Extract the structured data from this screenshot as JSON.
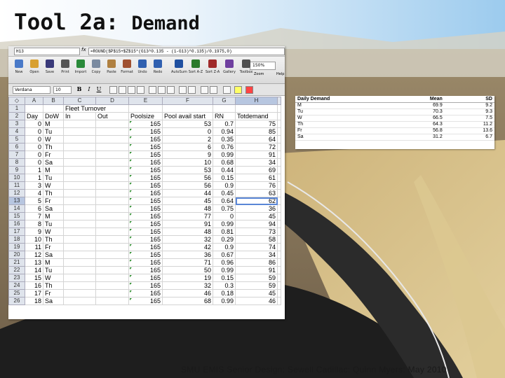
{
  "slide": {
    "title_main": "Tool 2a:",
    "title_sub": "Demand",
    "footer": "SMU EMIS Senior Design:  Sewell Cadillac:  Quinn Myers:  May 2010"
  },
  "spreadsheet": {
    "name_box": "H13",
    "fx_label": "fx",
    "formula": "=ROUND($P$15+$Z$15*(G13^0.135 - (1-G13)^0.135)/0.1975,0)",
    "toolbar": [
      {
        "label": "New",
        "icon": "new-icon",
        "color": "#4a7ac8"
      },
      {
        "label": "Open",
        "icon": "open-icon",
        "color": "#d8a030"
      },
      {
        "label": "Save",
        "icon": "save-icon",
        "color": "#3a3a7a"
      },
      {
        "label": "Print",
        "icon": "print-icon",
        "color": "#555555"
      },
      {
        "label": "Import",
        "icon": "import-icon",
        "color": "#2a8a3a"
      },
      {
        "label": "Copy",
        "icon": "copy-icon",
        "color": "#7a8aa0"
      },
      {
        "label": "Paste",
        "icon": "paste-icon",
        "color": "#b08040"
      },
      {
        "label": "Format",
        "icon": "format-icon",
        "color": "#a05030"
      },
      {
        "label": "Undo",
        "icon": "undo-icon",
        "color": "#3060b0"
      },
      {
        "label": "Redo",
        "icon": "redo-icon",
        "color": "#3060b0"
      },
      {
        "label": "AutoSum",
        "icon": "autosum-icon",
        "color": "#2050a0"
      },
      {
        "label": "Sort A-Z",
        "icon": "sort-az-icon",
        "color": "#2a7a2a"
      },
      {
        "label": "Sort Z-A",
        "icon": "sort-za-icon",
        "color": "#a02a2a"
      },
      {
        "label": "Gallery",
        "icon": "gallery-icon",
        "color": "#7040a0"
      },
      {
        "label": "Toolbox",
        "icon": "toolbox-icon",
        "color": "#505050"
      }
    ],
    "zoom": "150%",
    "zoom_label": "Zoom",
    "help_label": "Help",
    "font_name": "Verdana",
    "font_size": "10",
    "bold_glyph": "B",
    "italic_glyph": "I",
    "underline_glyph": "U",
    "columns": [
      "A",
      "B",
      "C",
      "D",
      "E",
      "F",
      "G",
      "H"
    ],
    "selected_row": "13",
    "header_row": [
      "Day",
      "DoW",
      "In",
      "Out",
      "Poolsize",
      "Pool avail start",
      "RN",
      "Totdemand"
    ],
    "group_label": "Fleet Turnover",
    "rows": [
      [
        "0",
        "M",
        "",
        "",
        "165",
        "53",
        "0.7",
        "75"
      ],
      [
        "0",
        "Tu",
        "",
        "",
        "165",
        "0",
        "0.94",
        "85"
      ],
      [
        "0",
        "W",
        "",
        "",
        "165",
        "2",
        "0.35",
        "64"
      ],
      [
        "0",
        "Th",
        "",
        "",
        "165",
        "6",
        "0.76",
        "72"
      ],
      [
        "0",
        "Fr",
        "",
        "",
        "165",
        "9",
        "0.99",
        "91"
      ],
      [
        "0",
        "Sa",
        "",
        "",
        "165",
        "10",
        "0.68",
        "34"
      ],
      [
        "1",
        "M",
        "",
        "",
        "165",
        "53",
        "0.44",
        "69"
      ],
      [
        "1",
        "Tu",
        "",
        "",
        "165",
        "56",
        "0.15",
        "61"
      ],
      [
        "3",
        "W",
        "",
        "",
        "165",
        "56",
        "0.9",
        "76"
      ],
      [
        "4",
        "Th",
        "",
        "",
        "165",
        "44",
        "0.45",
        "63"
      ],
      [
        "5",
        "Fr",
        "",
        "",
        "165",
        "45",
        "0.64",
        "62"
      ],
      [
        "6",
        "Sa",
        "",
        "",
        "165",
        "48",
        "0.75",
        "36"
      ],
      [
        "7",
        "M",
        "",
        "",
        "165",
        "77",
        "0",
        "45"
      ],
      [
        "8",
        "Tu",
        "",
        "",
        "165",
        "91",
        "0.99",
        "94"
      ],
      [
        "9",
        "W",
        "",
        "",
        "165",
        "48",
        "0.81",
        "73"
      ],
      [
        "10",
        "Th",
        "",
        "",
        "165",
        "32",
        "0.29",
        "58"
      ],
      [
        "11",
        "Fr",
        "",
        "",
        "165",
        "42",
        "0.9",
        "74"
      ],
      [
        "12",
        "Sa",
        "",
        "",
        "165",
        "36",
        "0.67",
        "34"
      ],
      [
        "13",
        "M",
        "",
        "",
        "165",
        "71",
        "0.96",
        "86"
      ],
      [
        "14",
        "Tu",
        "",
        "",
        "165",
        "50",
        "0.99",
        "91"
      ],
      [
        "15",
        "W",
        "",
        "",
        "165",
        "19",
        "0.15",
        "59"
      ],
      [
        "16",
        "Th",
        "",
        "",
        "165",
        "32",
        "0.3",
        "59"
      ],
      [
        "17",
        "Fr",
        "",
        "",
        "165",
        "46",
        "0.18",
        "45"
      ],
      [
        "18",
        "Sa",
        "",
        "",
        "165",
        "68",
        "0.99",
        "46"
      ]
    ]
  },
  "summary": {
    "headers": [
      "Daily Demand",
      "Mean",
      "SD"
    ],
    "rows": [
      [
        "M",
        "69.9",
        "9.2"
      ],
      [
        "Tu",
        "70.3",
        "9.3"
      ],
      [
        "W",
        "66.5",
        "7.5"
      ],
      [
        "Th",
        "64.3",
        "11.2"
      ],
      [
        "Fr",
        "56.8",
        "13.6"
      ],
      [
        "Sa",
        "31.2",
        "6.7"
      ]
    ]
  },
  "theme": {
    "sky_top": "#b8dcf4",
    "road": "#2a2a2a",
    "gold": "#d8c088"
  }
}
